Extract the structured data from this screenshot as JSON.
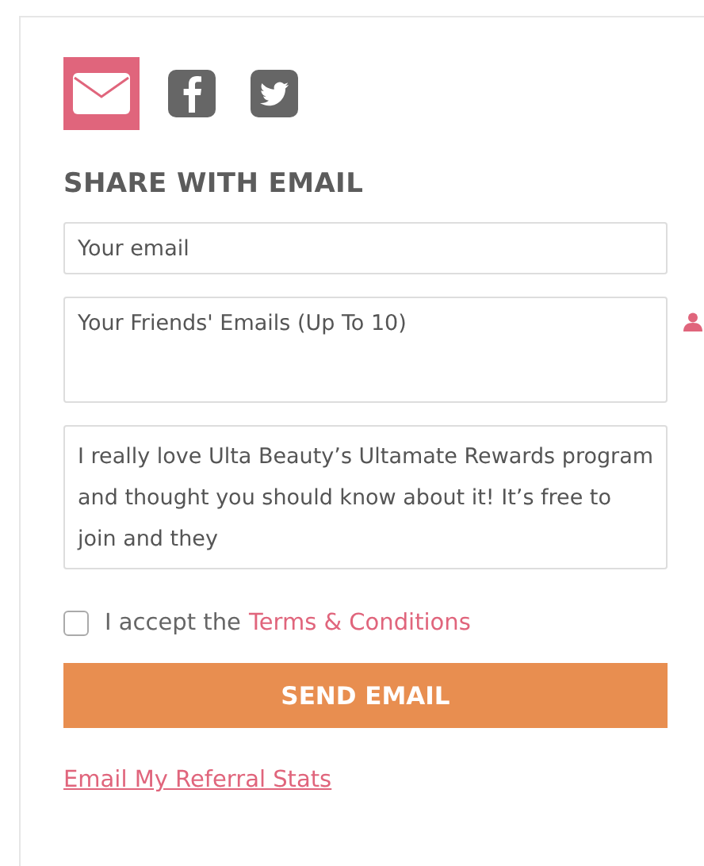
{
  "share_options": [
    {
      "kind": "email",
      "selected": true
    },
    {
      "kind": "facebook",
      "selected": false
    },
    {
      "kind": "twitter",
      "selected": false
    }
  ],
  "heading": "SHARE WITH EMAIL",
  "your_email": {
    "placeholder": "Your email"
  },
  "friends_emails": {
    "placeholder": "Your Friends' Emails (Up To 10)"
  },
  "message": {
    "value": "I really love Ulta Beauty’s Ultamate Rewards program and thought you should know about it! It’s free to join and they"
  },
  "terms": {
    "checked": false,
    "label": "I accept the",
    "link": "Terms & Conditions"
  },
  "send_button": "SEND EMAIL",
  "stats_link": "Email My Referral Stats"
}
